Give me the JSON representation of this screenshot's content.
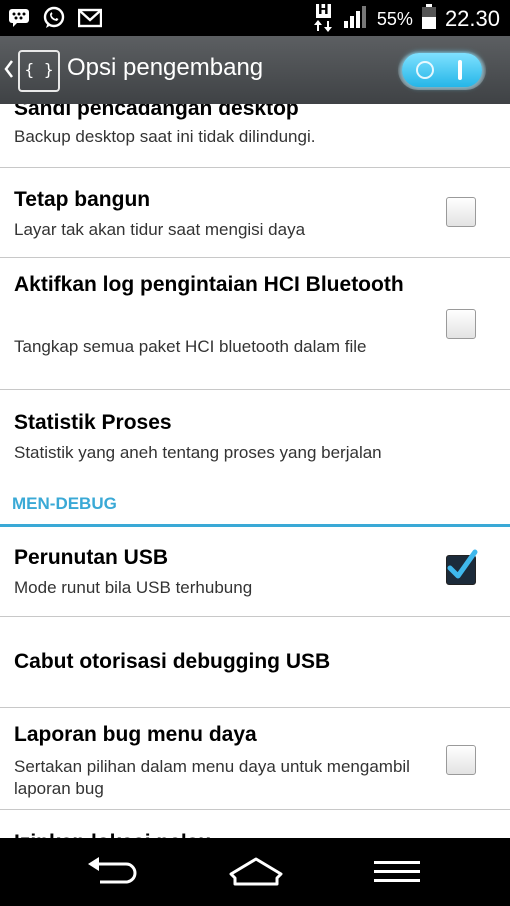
{
  "status_bar": {
    "icons_left": [
      "bbm-icon",
      "whatsapp-icon",
      "gmail-icon"
    ],
    "network_label": "H",
    "battery_percent": "55%",
    "time": "22.30"
  },
  "action_bar": {
    "app_icon_glyph": "{ }",
    "title": "Opsi pengembang",
    "toggle_on": true
  },
  "items": [
    {
      "title": "Sandi pencadangan desktop",
      "subtitle": "Backup desktop saat ini tidak dilindungi.",
      "checkbox": null
    },
    {
      "title": "Tetap bangun",
      "subtitle": "Layar tak akan tidur saat mengisi daya",
      "checkbox": false
    },
    {
      "title": "Aktifkan log pengintaian HCI Bluetooth",
      "subtitle": "Tangkap semua paket HCI bluetooth dalam file",
      "checkbox": false
    },
    {
      "title": "Statistik Proses",
      "subtitle": "Statistik yang aneh tentang proses yang berjalan",
      "checkbox": null
    }
  ],
  "section_header": "MEN-DEBUG",
  "debug_items": [
    {
      "title": "Perunutan USB",
      "subtitle": "Mode runut bila USB terhubung",
      "checkbox": true
    },
    {
      "title": "Cabut otorisasi debugging USB",
      "subtitle": "",
      "checkbox": null
    },
    {
      "title": "Laporan bug menu daya",
      "subtitle": "Sertakan pilihan dalam menu daya untuk mengambil laporan bug",
      "checkbox": false
    },
    {
      "title": "Izinkan lokasi palsu",
      "subtitle": "",
      "checkbox": null
    }
  ],
  "nav_bar": [
    "back-icon",
    "home-icon",
    "menu-icon"
  ],
  "colors": {
    "accent": "#3aa9d6",
    "toggle": "#25b6e8"
  }
}
